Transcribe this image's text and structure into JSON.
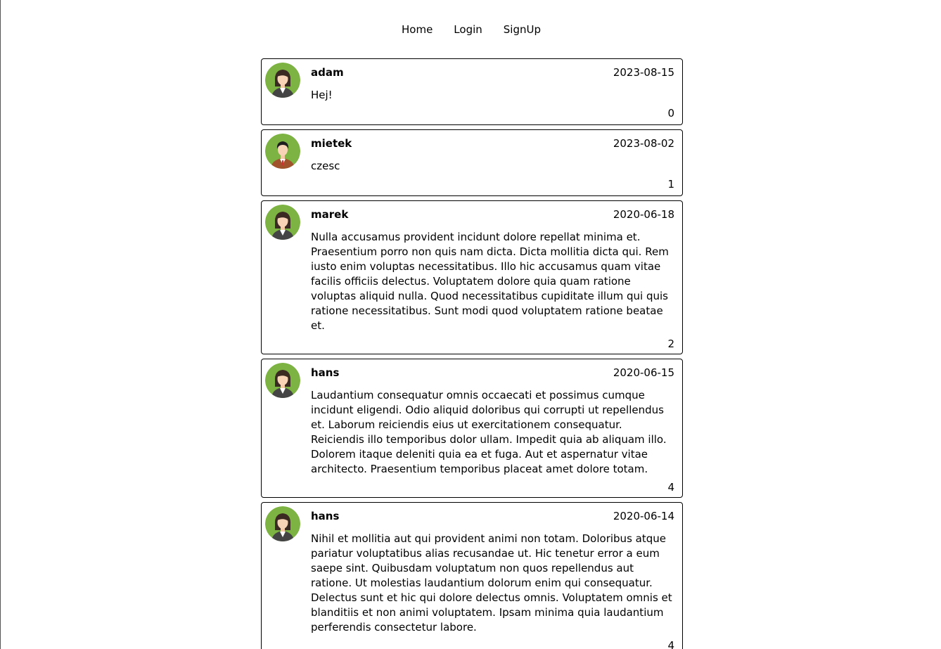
{
  "nav": {
    "home": "Home",
    "login": "Login",
    "signup": "SignUp"
  },
  "posts": [
    {
      "author": "adam",
      "date": "2023-08-15",
      "body": "Hej!",
      "count": "0",
      "avatar": "female-avatar-icon"
    },
    {
      "author": "mietek",
      "date": "2023-08-02",
      "body": "czesc",
      "count": "1",
      "avatar": "male-avatar-icon"
    },
    {
      "author": "marek",
      "date": "2020-06-18",
      "body": "Nulla accusamus provident incidunt dolore repellat minima et. Praesentium porro non quis nam dicta. Dicta mollitia dicta qui. Rem iusto enim voluptas necessitatibus. Illo hic accusamus quam vitae facilis officiis delectus. Voluptatem dolore quia quam ratione voluptas aliquid nulla. Quod necessitatibus cupiditate illum qui quis ratione necessitatibus. Sunt modi quod voluptatem ratione beatae et.",
      "count": "2",
      "avatar": "female-avatar-icon"
    },
    {
      "author": "hans",
      "date": "2020-06-15",
      "body": "Laudantium consequatur omnis occaecati et possimus cumque incidunt eligendi. Odio aliquid doloribus qui corrupti ut repellendus et. Laborum reiciendis eius ut exercitationem consequatur. Reiciendis illo temporibus dolor ullam. Impedit quia ab aliquam illo. Dolorem itaque deleniti quia ea et fuga. Aut et aspernatur vitae architecto. Praesentium temporibus placeat amet dolore totam.",
      "count": "4",
      "avatar": "female-avatar-icon"
    },
    {
      "author": "hans",
      "date": "2020-06-14",
      "body": "Nihil et mollitia aut qui provident animi non totam. Doloribus atque pariatur voluptatibus alias recusandae ut. Hic tenetur error a eum saepe sint. Quibusdam voluptatum non quos repellendus aut ratione. Ut molestias laudantium dolorum enim qui consequatur. Delectus sunt et hic qui dolore delectus omnis. Voluptatem omnis et blanditiis et non animi voluptatem. Ipsam minima quia laudantium perferendis consectetur labore.",
      "count": "4",
      "avatar": "female-avatar-icon"
    }
  ],
  "colors": {
    "avatar_bg": "#7cb342",
    "border": "#000000"
  }
}
